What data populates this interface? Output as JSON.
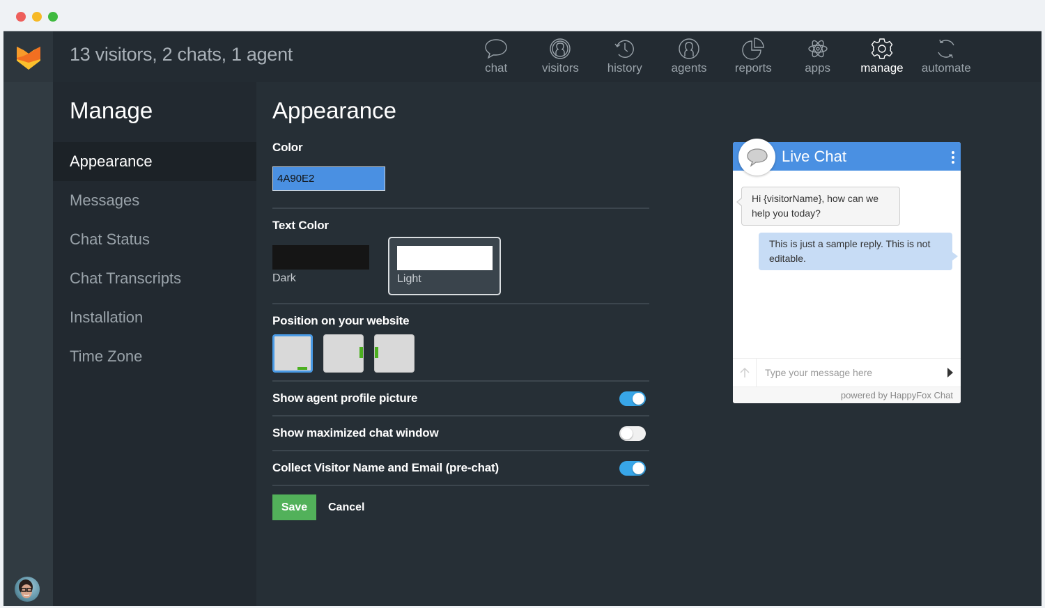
{
  "window": {
    "controls": [
      "close",
      "minimize",
      "maximize"
    ]
  },
  "header": {
    "status_text": "13 visitors, 2 chats, 1 agent",
    "nav": [
      {
        "label": "chat",
        "icon": "chat-bubble-icon",
        "active": false
      },
      {
        "label": "visitors",
        "icon": "visitors-icon",
        "active": false
      },
      {
        "label": "history",
        "icon": "history-icon",
        "active": false
      },
      {
        "label": "agents",
        "icon": "agents-icon",
        "active": false
      },
      {
        "label": "reports",
        "icon": "pie-chart-icon",
        "active": false
      },
      {
        "label": "apps",
        "icon": "atom-icon",
        "active": false
      },
      {
        "label": "manage",
        "icon": "gear-icon",
        "active": true
      },
      {
        "label": "automate",
        "icon": "refresh-icon",
        "active": false
      }
    ]
  },
  "sidebar": {
    "title": "Manage",
    "items": [
      {
        "label": "Appearance",
        "active": true
      },
      {
        "label": "Messages",
        "active": false
      },
      {
        "label": "Chat Status",
        "active": false
      },
      {
        "label": "Chat Transcripts",
        "active": false
      },
      {
        "label": "Installation",
        "active": false
      },
      {
        "label": "Time Zone",
        "active": false
      }
    ]
  },
  "main": {
    "title": "Appearance",
    "color": {
      "label": "Color",
      "value": "4A90E2",
      "swatch": "#4a90e2"
    },
    "text_color": {
      "label": "Text Color",
      "options": [
        {
          "label": "Dark",
          "swatch": "#151515",
          "selected": false
        },
        {
          "label": "Light",
          "swatch": "#ffffff",
          "selected": true
        }
      ]
    },
    "position": {
      "label": "Position on your website",
      "options": [
        {
          "name": "bottom-right",
          "selected": true
        },
        {
          "name": "right-middle",
          "selected": false
        },
        {
          "name": "left-middle",
          "selected": false
        }
      ]
    },
    "toggles": [
      {
        "label": "Show agent profile picture",
        "on": true
      },
      {
        "label": "Show maximized chat window",
        "on": false
      },
      {
        "label": "Collect Visitor Name and Email (pre-chat)",
        "on": true
      }
    ],
    "save_label": "Save",
    "cancel_label": "Cancel"
  },
  "preview": {
    "title": "Live Chat",
    "incoming_message": "Hi {visitorName}, how can we help you today?",
    "outgoing_message": "This is just a sample reply. This is not editable.",
    "input_placeholder": "Type your message here",
    "powered_by": "powered by HappyFox Chat",
    "header_color": "#4a90e2"
  },
  "colors": {
    "accent": "#4a90e2",
    "save_button": "#52b15a",
    "toggle_on": "#38a6e8",
    "position_marker": "#4caf20"
  }
}
